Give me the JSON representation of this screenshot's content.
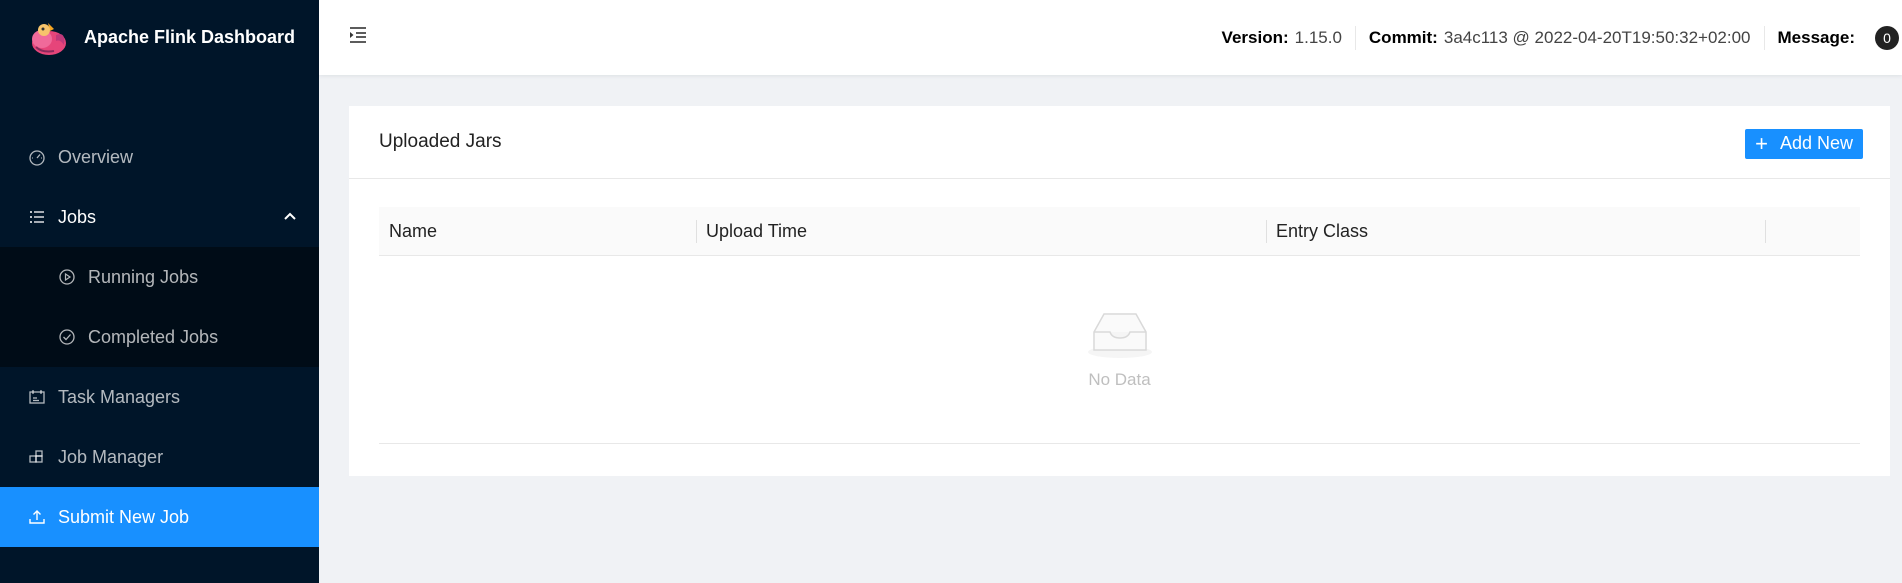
{
  "brand": {
    "title": "Apache Flink Dashboard",
    "logo_icon": "squirrel-logo-icon"
  },
  "sidebar": {
    "items": [
      {
        "label": "Overview",
        "icon": "dashboard-icon"
      },
      {
        "label": "Jobs",
        "icon": "list-icon"
      },
      {
        "label": "Running Jobs",
        "icon": "play-circle-icon"
      },
      {
        "label": "Completed Jobs",
        "icon": "check-circle-icon"
      },
      {
        "label": "Task Managers",
        "icon": "schedule-icon"
      },
      {
        "label": "Job Manager",
        "icon": "build-icon"
      },
      {
        "label": "Submit New Job",
        "icon": "upload-icon"
      }
    ],
    "active_color": "#1890ff",
    "bg_color": "#001529"
  },
  "header": {
    "version_label": "Version:",
    "version_value": "1.15.0",
    "commit_label": "Commit:",
    "commit_value": "3a4c113 @ 2022-04-20T19:50:32+02:00",
    "message_label": "Message:",
    "message_count": "0"
  },
  "card": {
    "title": "Uploaded Jars",
    "add_button": "Add New",
    "columns": [
      "Name",
      "Upload Time",
      "Entry Class",
      ""
    ],
    "empty_text": "No Data"
  }
}
